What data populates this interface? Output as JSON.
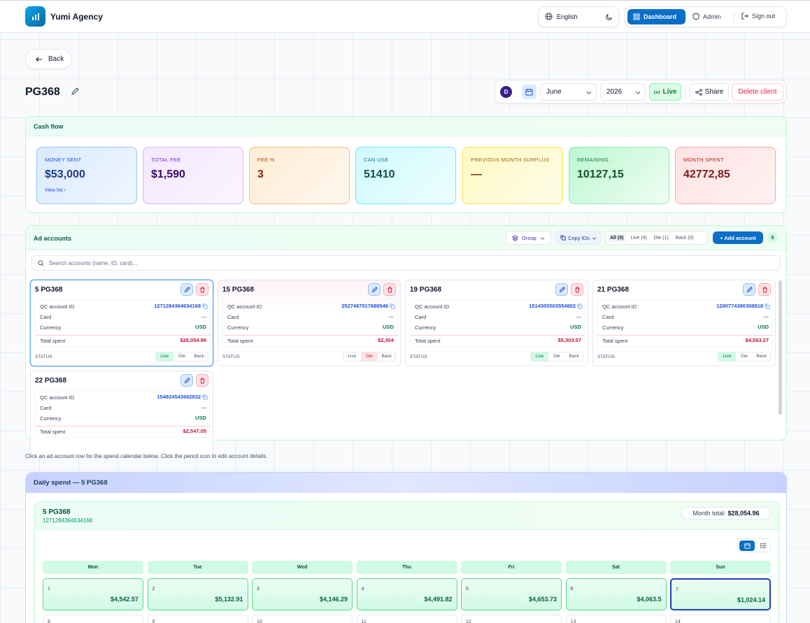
{
  "header": {
    "brand": "Yumi Agency",
    "language": "English",
    "nav": {
      "dashboard": "Dashboard",
      "admin": "Admin",
      "signout": "Sign out"
    }
  },
  "back_label": "Back",
  "client": {
    "title": "PG368",
    "avatar_letter": "D",
    "month": "June",
    "year": "2026",
    "live_label": "Live",
    "share_label": "Share",
    "delete_label": "Delete client"
  },
  "cashflow": {
    "title": "Cash flow",
    "stats": [
      {
        "label": "MONEY SENT",
        "value": "$53,000",
        "sub": "View list ›"
      },
      {
        "label": "TOTAL FEE",
        "value": "$1,590"
      },
      {
        "label": "FEE %",
        "value": "3"
      },
      {
        "label": "CAN USE",
        "value": "51410"
      },
      {
        "label": "PREVIOUS MONTH SURPLUS",
        "value": "—"
      },
      {
        "label": "REMAINING",
        "value": "10127,15"
      },
      {
        "label": "MONTH SPENT",
        "value": "42772,85"
      }
    ],
    "colors": [
      "#1e3a8a",
      "#3b0764",
      "#7c2d12",
      "#134e4a",
      "#713f12",
      "#14532d",
      "#7f1d1d"
    ]
  },
  "ad_accounts": {
    "title": "Ad accounts",
    "group_label": "Group",
    "copy_ids_label": "Copy IDs",
    "filters": [
      "All (5)",
      "Live (4)",
      "Die (1)",
      "Back (0)"
    ],
    "add_label": "+ Add account",
    "count": "5",
    "search_placeholder": "Search accounts (name, ID, card)...",
    "row_labels": {
      "qc": "QC account ID",
      "card": "Card",
      "currency": "Currency",
      "total": "Total spent",
      "status": "STATUS"
    },
    "status_options": [
      "Live",
      "Die",
      "Back"
    ],
    "cards": [
      {
        "name": "5 PG368",
        "qc_id": "1271284364634168",
        "card": "—",
        "currency": "USD",
        "total": "$28,054.96",
        "status": "Live"
      },
      {
        "name": "15 PG368",
        "qc_id": "2527467517689546",
        "card": "—",
        "currency": "USD",
        "total": "$2,304",
        "status": "Die"
      },
      {
        "name": "19 PG368",
        "qc_id": "1514300503554802",
        "card": "—",
        "currency": "USD",
        "total": "$5,303.57",
        "status": "Live"
      },
      {
        "name": "21 PG368",
        "qc_id": "1280774380308818",
        "card": "—",
        "currency": "USD",
        "total": "$4,563.27",
        "status": "Live"
      },
      {
        "name": "22 PG368",
        "qc_id": "154924543662832",
        "card": "—",
        "currency": "USD",
        "total": "$2,547.05",
        "status": "Live"
      }
    ]
  },
  "hint": "Click an ad account row for the spend calendar below. Click the pencil icon to edit account details.",
  "daily": {
    "title": "Daily spend — 5 PG368",
    "account_name": "5 PG368",
    "account_id": "1271284364634168",
    "month_total_label": "Month total:",
    "month_total": "$28,054.96",
    "weekdays": [
      "Mon",
      "Tue",
      "Wed",
      "Thu",
      "Fri",
      "Sat",
      "Sun"
    ],
    "days": [
      {
        "d": "1",
        "amt": "$4,542.57"
      },
      {
        "d": "2",
        "amt": "$5,132.91"
      },
      {
        "d": "3",
        "amt": "$4,146.29"
      },
      {
        "d": "4",
        "amt": "$4,491.82"
      },
      {
        "d": "5",
        "amt": "$4,653.73"
      },
      {
        "d": "6",
        "amt": "$4,063.5"
      },
      {
        "d": "7",
        "amt": "$1,024.14"
      }
    ],
    "next_days": [
      "8",
      "9",
      "10",
      "11",
      "12",
      "13",
      "14"
    ]
  }
}
